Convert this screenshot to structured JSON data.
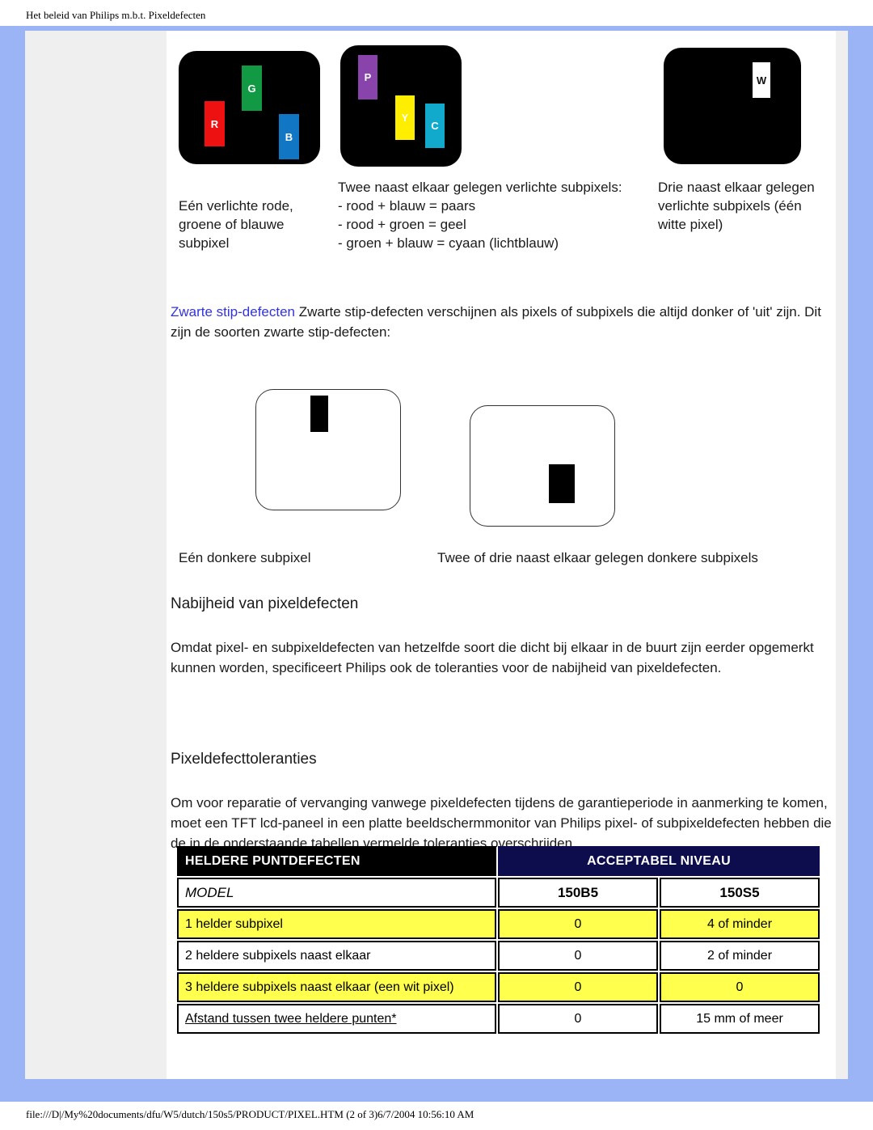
{
  "browser": {
    "header_title": "Het beleid van Philips m.b.t. Pixeldefecten",
    "footer_path": "file:///D|/My%20documents/dfu/W5/dutch/150s5/PRODUCT/PIXEL.HTM (2 of 3)6/7/2004 10:56:10 AM"
  },
  "colors": {
    "frame_blue": "#9ab4f5",
    "rail_gray": "#efefef",
    "header_black": "#000000",
    "header_navy": "#0d0d4d",
    "row_yellow": "#ffff4d",
    "link_blue": "#3333dd"
  },
  "bright_defects": {
    "panels": [
      {
        "name": "single-bright-subpixel",
        "subpixels": [
          {
            "label": "R",
            "color": "#ee1111"
          },
          {
            "label": "G",
            "color": "#119944"
          },
          {
            "label": "B",
            "color": "#1177c4"
          }
        ]
      },
      {
        "name": "two-adjacent-bright-subpixels",
        "subpixels": [
          {
            "label": "P",
            "color": "#8844aa"
          },
          {
            "label": "Y",
            "color": "#ffee00"
          },
          {
            "label": "C",
            "color": "#11aacc"
          }
        ]
      },
      {
        "name": "three-adjacent-bright-subpixels",
        "subpixels": [
          {
            "label": "W",
            "color": "#ffffff"
          }
        ]
      }
    ],
    "caption_1": "Eén verlichte rode, groene of blauwe subpixel",
    "caption_2_title": "Twee naast elkaar gelegen verlichte subpixels:",
    "caption_2_lines": [
      "- rood + blauw = paars",
      "- rood + groen = geel",
      "- groen + blauw = cyaan (lichtblauw)"
    ],
    "caption_3": "Drie naast elkaar gelegen verlichte subpixels (één witte pixel)"
  },
  "black_dot_section": {
    "lead_link": "Zwarte stip-defecten",
    "lead_text": " Zwarte stip-defecten verschijnen als pixels of subpixels die altijd donker of 'uit' zijn. Dit zijn de soorten zwarte stip-defecten:",
    "caption_1": "Eén donkere subpixel",
    "caption_2": "Twee of drie naast elkaar gelegen donkere subpixels"
  },
  "proximity_section": {
    "heading": "Nabijheid van pixeldefecten",
    "body": "Omdat pixel- en subpixeldefecten van hetzelfde soort die dicht bij elkaar in de buurt zijn eerder opgemerkt kunnen worden, specificeert Philips ook de toleranties voor de nabijheid van pixeldefecten."
  },
  "tolerance_section": {
    "heading": "Pixeldefecttoleranties",
    "body": "Om voor reparatie of vervanging vanwege pixeldefecten tijdens de garantieperiode in aanmerking te komen, moet een TFT lcd-paneel in een platte beeldschermmonitor van Philips pixel- of subpixeldefecten hebben die de in de onderstaande tabellen vermelde toleranties overschrijden."
  },
  "table": {
    "header_left": "HELDERE PUNTDEFECTEN",
    "header_right": "ACCEPTABEL NIVEAU",
    "model_label": "MODEL",
    "model_columns": [
      "150B5",
      "150S5"
    ],
    "rows": [
      {
        "label": "1 helder subpixel",
        "values": [
          "0",
          "4 of minder"
        ],
        "highlight": true,
        "underline": false
      },
      {
        "label": "2 heldere subpixels naast elkaar",
        "values": [
          "0",
          "2 of minder"
        ],
        "highlight": false,
        "underline": false
      },
      {
        "label": "3 heldere subpixels naast elkaar (een wit pixel)",
        "values": [
          "0",
          "0"
        ],
        "highlight": true,
        "underline": false
      },
      {
        "label": "Afstand tussen twee heldere punten*",
        "values": [
          "0",
          "15 mm of meer"
        ],
        "highlight": false,
        "underline": true
      }
    ]
  }
}
